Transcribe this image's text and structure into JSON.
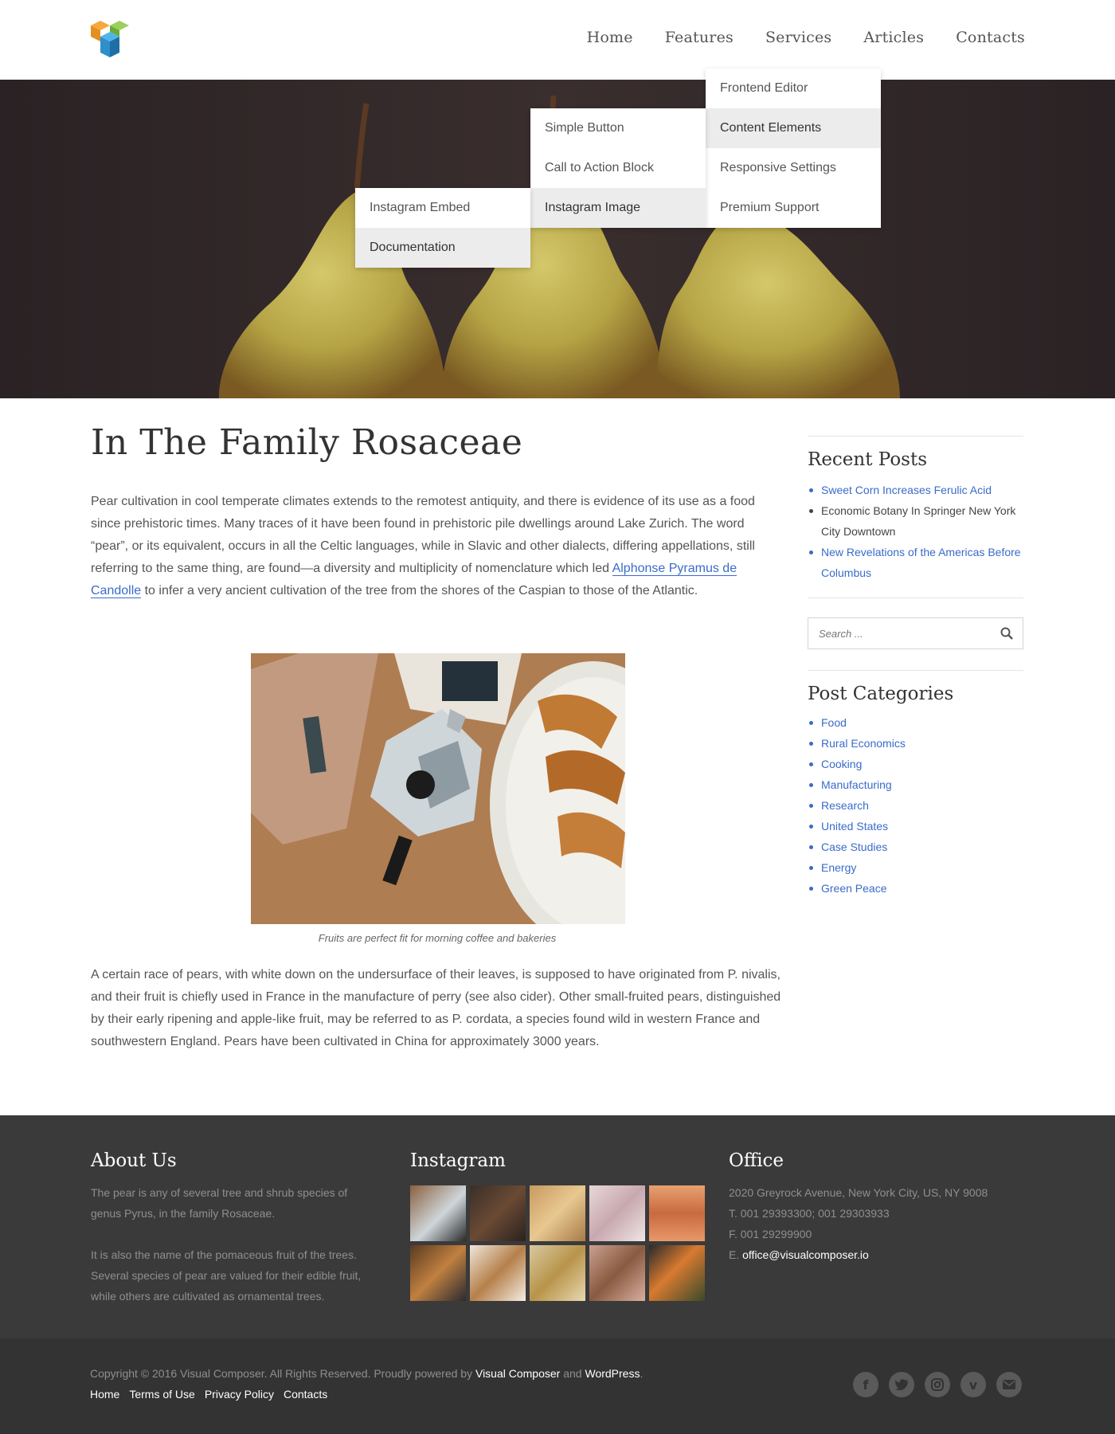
{
  "nav": {
    "items": [
      {
        "label": "Home"
      },
      {
        "label": "Features"
      },
      {
        "label": "Services"
      },
      {
        "label": "Articles"
      },
      {
        "label": "Contacts"
      }
    ]
  },
  "dropdown": {
    "level1": [
      "Frontend Editor",
      "Content Elements",
      "Responsive Settings",
      "Premium Support"
    ],
    "level2": [
      "Simple Button",
      "Call to Action Block",
      "Instagram Image"
    ],
    "level3": [
      "Instagram Embed",
      "Documentation"
    ]
  },
  "article": {
    "title": "In The Family Rosaceae",
    "para1_a": "Pear cultivation in cool temperate climates extends to the remotest antiquity, and there is evidence of its use as a food since prehistoric times. Many traces of it have been found in prehistoric pile dwellings around Lake Zurich. The word “pear”, or its equivalent, occurs in all the Celtic languages, while in Slavic and other dialects, differing appellations, still referring to the same thing, are found—a diversity and multiplicity of nomenclature which led ",
    "para1_link": "Alphonse Pyramus de Candolle",
    "para1_b": " to infer a very ancient cultivation of the tree from the shores of the Caspian to those of the Atlantic.",
    "caption": "Fruits are perfect fit for morning coffee and bakeries",
    "para2": "A certain race of pears, with white down on the undersurface of their leaves, is supposed to have originated from P. nivalis, and their fruit is chiefly used in France in the manufacture of perry (see also cider). Other small-fruited pears, distinguished by their early ripening and apple-like fruit, may be referred to as P. cordata, a species found wild in western France and southwestern England. Pears have been cultivated in China for approximately 3000 years."
  },
  "sidebar": {
    "recent_title": "Recent Posts",
    "recent": [
      "Sweet Corn Increases Ferulic Acid",
      "Economic Botany In Springer New York City Downtown",
      "New Revelations of the Americas Before Columbus"
    ],
    "search_placeholder": "Search ...",
    "categories_title": "Post Categories",
    "categories": [
      "Food",
      "Rural Economics",
      "Cooking",
      "Manufacturing",
      "Research",
      "United States",
      "Case Studies",
      "Energy",
      "Green Peace"
    ]
  },
  "footer": {
    "about_title": "About Us",
    "about_p1": "The pear is any of several tree and shrub species of genus Pyrus, in the family Rosaceae.",
    "about_p2": "It is also the name of the pomaceous fruit of the trees. Several species of pear are valued for their edible fruit, while others are cultivated as ornamental trees.",
    "instagram_title": "Instagram",
    "office_title": "Office",
    "address": "2020 Greyrock Avenue, New York City, US, NY 9008",
    "phone": "T. 001 29393300; 001 29303933",
    "fax": "F. 001 29299900",
    "email_prefix": "E.",
    "email": "office@visualcomposer.io"
  },
  "bottom": {
    "copy_a": "Copyright © 2016 Visual Composer. All Rights Reserved. Proudly powered by ",
    "vc": "Visual Composer",
    "and": " and ",
    "wp": "WordPress",
    "dot": ".",
    "links": [
      "Home",
      "Terms of Use",
      "Privacy Policy",
      "Contacts"
    ],
    "social": [
      "facebook-icon",
      "twitter-icon",
      "instagram-icon",
      "vimeo-icon",
      "email-icon"
    ]
  }
}
